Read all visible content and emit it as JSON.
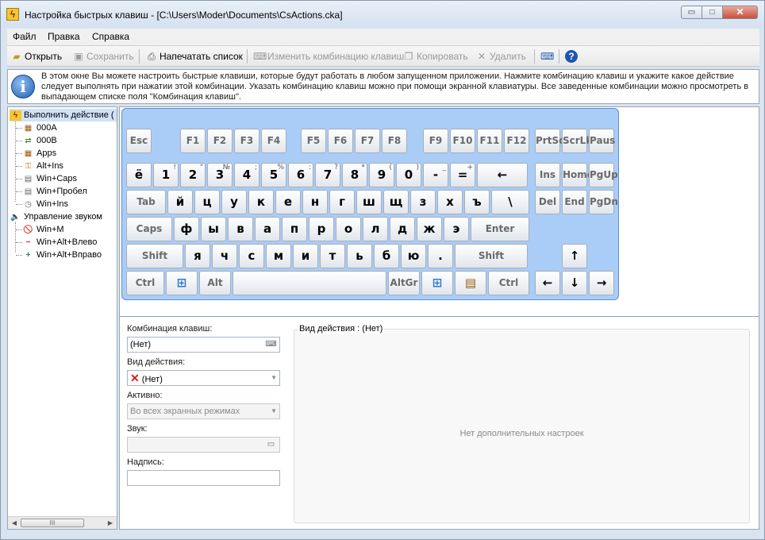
{
  "window": {
    "title": "Настройка быстрых клавиш - [C:\\Users\\Moder\\Documents\\CsActions.cka]",
    "app_icon": "lightning-icon",
    "minimize_glyph": "▭",
    "maximize_glyph": "□",
    "close_glyph": "✕"
  },
  "menu": {
    "items": [
      {
        "label": "Файл"
      },
      {
        "label": "Правка"
      },
      {
        "label": "Справка"
      }
    ]
  },
  "toolbar": {
    "open": {
      "label": "Открыть",
      "icon": "folder-open-icon"
    },
    "save": {
      "label": "Сохранить",
      "icon": "floppy-icon"
    },
    "print": {
      "label": "Напечатать список",
      "icon": "printer-icon"
    },
    "change": {
      "label": "Изменить комбинацию клавиш",
      "icon": "keyboard-edit-icon"
    },
    "copy": {
      "label": "Копировать",
      "icon": "copy-icon"
    },
    "delete": {
      "label": "Удалить",
      "icon": "delete-icon"
    },
    "keyboard_icon": "keyboard-icon",
    "help_icon": "help-icon"
  },
  "info": {
    "text": "В этом окне Вы можете настроить быстрые клавиши, которые будут работать в любом запущенном приложении. Нажмите комбинацию клавиш и укажите какое действие следует выполнять при нажатии этой комбинации. Указать комбинацию клавиш можно при помощи экранной клавиатуры. Все заведенные комбинации можно просмотреть в выпадающем списке поля \"Комбинация клавиш\"."
  },
  "tree": {
    "group1": "Выполнить действие (",
    "group1_items": [
      "000A",
      "000B",
      "Apps",
      "Alt+Ins",
      "Win+Caps",
      "Win+Пробел",
      "Win+Ins"
    ],
    "group2": "Управление звуком",
    "group2_items": [
      "Win+M",
      "Win+Alt+Влево",
      "Win+Alt+Вправо"
    ],
    "scroll_thumb": "III"
  },
  "keyboard": {
    "row_fn": [
      "Esc",
      "F1",
      "F2",
      "F3",
      "F4",
      "F5",
      "F6",
      "F7",
      "F8",
      "F9",
      "F10",
      "F11",
      "F12",
      "PrtSc",
      "ScrLk",
      "Paus"
    ],
    "row_num": [
      {
        "k": "ё",
        "s": ""
      },
      {
        "k": "1",
        "s": "!"
      },
      {
        "k": "2",
        "s": "\""
      },
      {
        "k": "3",
        "s": "№"
      },
      {
        "k": "4",
        "s": ";"
      },
      {
        "k": "5",
        "s": "%"
      },
      {
        "k": "6",
        "s": ":"
      },
      {
        "k": "7",
        "s": "?"
      },
      {
        "k": "8",
        "s": "*"
      },
      {
        "k": "9",
        "s": "("
      },
      {
        "k": "0",
        "s": ")"
      },
      {
        "k": "-",
        "s": "_"
      },
      {
        "k": "=",
        "s": "+"
      },
      {
        "k": "←",
        "s": ""
      }
    ],
    "row_q": [
      "Tab",
      "й",
      "ц",
      "у",
      "к",
      "е",
      "н",
      "г",
      "ш",
      "щ",
      "з",
      "х",
      "ъ",
      "\\"
    ],
    "row_a": [
      "Caps",
      "ф",
      "ы",
      "в",
      "а",
      "п",
      "р",
      "о",
      "л",
      "д",
      "ж",
      "э",
      "Enter"
    ],
    "row_z": [
      "Shift",
      "я",
      "ч",
      "с",
      "м",
      "и",
      "т",
      "ь",
      "б",
      "ю",
      ".",
      "Shift"
    ],
    "row_bottom": [
      "Ctrl",
      "Alt",
      "AltGr",
      "Ctrl"
    ],
    "nav": [
      "Ins",
      "Home",
      "PgUp",
      "Del",
      "End",
      "PgDn"
    ],
    "arrows": [
      "↑",
      "←",
      "↓",
      "→"
    ],
    "win_icon": "windows-logo-icon",
    "menu_icon": "menu-key-icon"
  },
  "form": {
    "combo_label": "Комбинация клавиш:",
    "combo_value": "(Нет)",
    "action_label": "Вид действия:",
    "action_value": "(Нет)",
    "active_label": "Активно:",
    "active_value": "Во всех экранных режимах",
    "sound_label": "Звук:",
    "sound_value": "",
    "caption_label": "Надпись:",
    "caption_value": ""
  },
  "action_group": {
    "title": "Вид действия : (Нет)",
    "empty": "Нет дополнительных настроек"
  }
}
